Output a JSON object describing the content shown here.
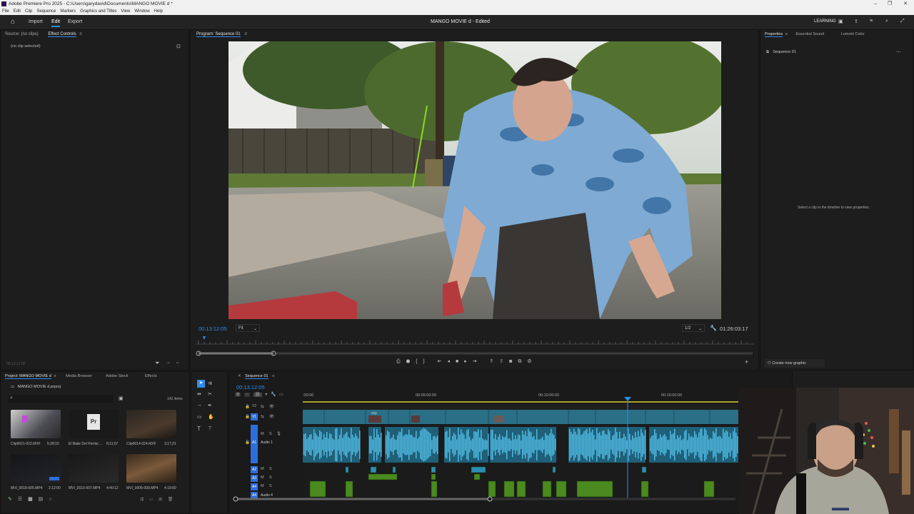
{
  "titlebar": {
    "text": "Adobe Premiere Pro 2025 - C:\\Users\\garydavid\\Documents\\MANGO MOVIE d *"
  },
  "menubar": [
    "File",
    "Edit",
    "Clip",
    "Sequence",
    "Markers",
    "Graphics and Titles",
    "View",
    "Window",
    "Help"
  ],
  "header": {
    "home_icon": "home-icon",
    "tabs": [
      "Import",
      "Edit",
      "Export"
    ],
    "project_title": "MANGO MOVIE d",
    "edited_label": "- Edited",
    "learning": "LEARNING"
  },
  "source_panel": {
    "tab_source": "Source: (no clips)",
    "tab_effect_controls": "Effect Controls",
    "no_clip": "(no clip selected)",
    "bottom_tc": "00:13:12:05"
  },
  "program": {
    "tab": "Program: Sequence 01",
    "timecode": "00:13:12:05",
    "fit": "Fit",
    "resolution": "1/2",
    "duration": "01:26:03:17"
  },
  "properties": {
    "tabs": [
      "Properties",
      "Essential Sound",
      "Lumetri Color"
    ],
    "sequence": "Sequence 01",
    "hint": "Select a clip in the timeline to view properties.",
    "create_graphic": "Create new graphic"
  },
  "project": {
    "tabs": [
      "Project: MANGO MOVIE d",
      "Media Browser",
      "Adobe Stock",
      "Effects"
    ],
    "file": "MANGO MOVIE d.prproj",
    "items_count": "142 items",
    "clips": [
      {
        "name": "Clip0021-022.MXF",
        "dur": "5;28;10"
      },
      {
        "name": "El Baile Del Perrito ...",
        "dur": "8;11;07"
      },
      {
        "name": "Clip0014-024.MXF",
        "dur": "3;17;21"
      },
      {
        "name": "MVI_0018-005.MP4",
        "dur": "2:12:00"
      },
      {
        "name": "MVI_0010-007.MP4",
        "dur": "4:40:12"
      },
      {
        "name": "MVI_0006-009.MP4",
        "dur": "4:19:00"
      }
    ]
  },
  "timeline": {
    "tab": "Sequence 01",
    "timecode": "00:13:12:05",
    "ruler": [
      ":00:00",
      "00:05:00:00",
      "00:10:00:00",
      "00:15:00:00"
    ],
    "tracks": [
      {
        "id": "V2",
        "label": ""
      },
      {
        "id": "V1",
        "label": ""
      },
      {
        "id": "A1",
        "label": "Audio 1"
      },
      {
        "id": "A2",
        "label": ""
      },
      {
        "id": "A3",
        "label": ""
      },
      {
        "id": "A4",
        "label": ""
      },
      {
        "id": "A4",
        "label": "Audio 4"
      }
    ],
    "clip_label": "Clip"
  },
  "colors": {
    "accent": "#2d8ceb",
    "video_clip": "#2a6f86",
    "audio_clip": "#2c8eb2",
    "green_clip": "#4a8a1e",
    "playhead_yellow": "#d8d22e"
  }
}
